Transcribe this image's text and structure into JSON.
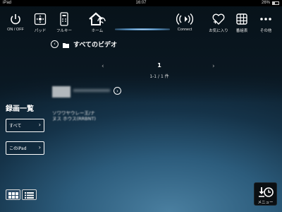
{
  "status_bar": {
    "device": "iPad",
    "time": "16:07",
    "battery": "26%"
  },
  "toolbar": {
    "items": [
      {
        "label": "ON / OFF",
        "icon": "power-icon"
      },
      {
        "label": "パッド",
        "icon": "dpad-icon"
      },
      {
        "label": "フルキー",
        "icon": "remote-icon"
      },
      {
        "label": "ホーム",
        "icon": "home-icon"
      },
      {
        "label": "Connect",
        "icon": "connect-icon"
      },
      {
        "label": "お気に入り",
        "icon": "favorite-add-icon"
      },
      {
        "label": "番組表",
        "icon": "program-guide-icon"
      },
      {
        "label": "その他",
        "icon": "more-icon"
      }
    ]
  },
  "header": {
    "back_icon": "back-icon",
    "folder_icon": "folder-icon",
    "title": "すべてのビデオ"
  },
  "pagination": {
    "prev": "‹",
    "next": "›",
    "current_page": "1",
    "count_text": "1-1 / 1 件"
  },
  "item": {
    "line1": "ソワワヤウレー王/ナ",
    "line2": "ヌス ホウス(RRBNT)"
  },
  "sidebar": {
    "title": "録画一覧",
    "filters": [
      {
        "label": "すべて"
      },
      {
        "label": "このiPad"
      }
    ]
  },
  "view_toggle": {
    "grid_icon": "grid-view-icon",
    "list_icon": "list-view-icon",
    "selected": "grid"
  },
  "menu_button": {
    "label": "メニュー",
    "icon": "download-clock-icon"
  },
  "colors": {
    "background_glow": "#4a7fa0",
    "background_dark": "#0a1a26",
    "accent_line": "#5e9ccf",
    "selected_toggle": "#2a4a66"
  }
}
